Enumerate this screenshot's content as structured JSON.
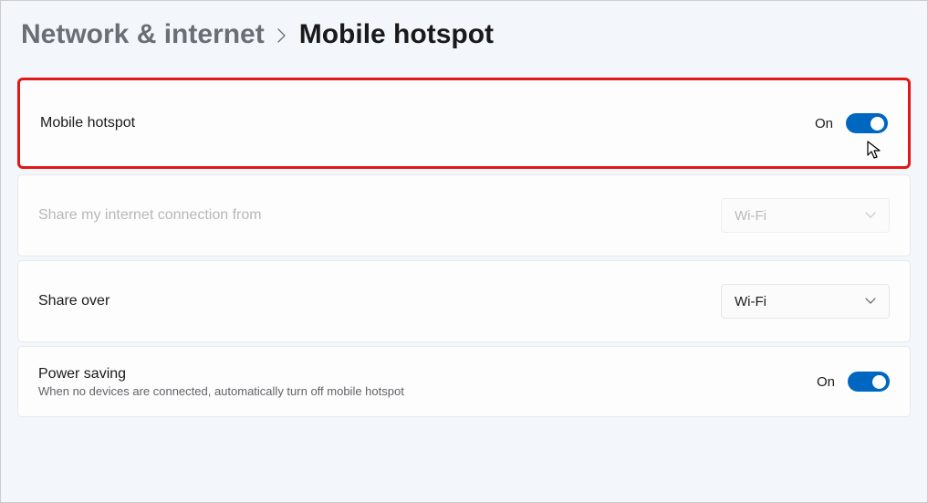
{
  "breadcrumb": {
    "parent": "Network & internet",
    "current": "Mobile hotspot"
  },
  "rows": {
    "hotspot": {
      "label": "Mobile hotspot",
      "state": "On"
    },
    "shareFrom": {
      "label": "Share my internet connection from",
      "value": "Wi-Fi"
    },
    "shareOver": {
      "label": "Share over",
      "value": "Wi-Fi"
    },
    "powerSaving": {
      "label": "Power saving",
      "sublabel": "When no devices are connected, automatically turn off mobile hotspot",
      "state": "On"
    }
  }
}
